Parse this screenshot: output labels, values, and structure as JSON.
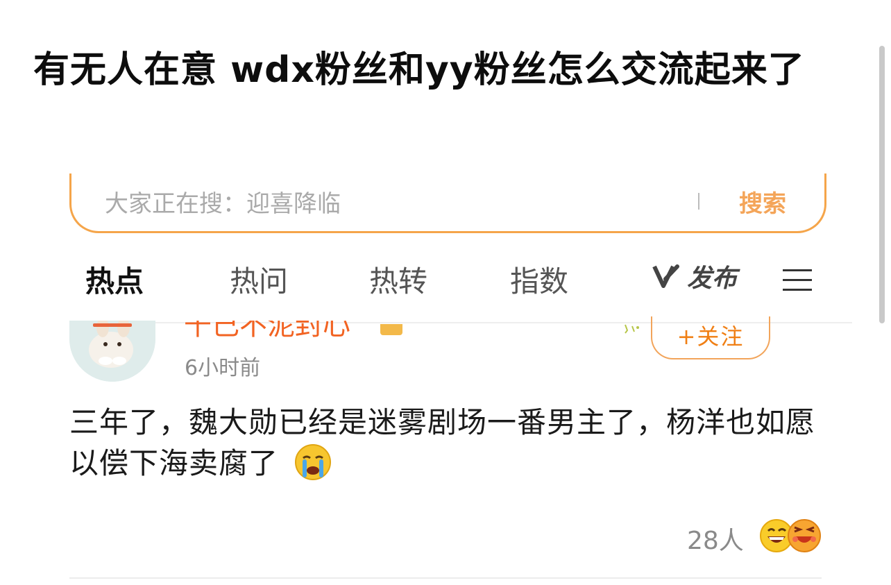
{
  "post": {
    "title": "有无人在意 wdx粉丝和yy粉丝怎么交流起来了"
  },
  "app": {
    "search": {
      "placeholder": "大家正在搜：迎喜降临",
      "button_label": "搜索"
    },
    "tabs": [
      {
        "label": "热点",
        "active": true
      },
      {
        "label": "热问",
        "active": false
      },
      {
        "label": "热转",
        "active": false
      },
      {
        "label": "指数",
        "active": false
      }
    ],
    "publish_label": "发布",
    "colors": {
      "accent": "#f07f14",
      "username": "#f26322",
      "search_border": "#f5a54a"
    }
  },
  "card": {
    "username": "千己不泥封心",
    "timestamp": "6小时前",
    "follow_label": "+关注",
    "text": "三年了，魏大勋已经是迷雾剧场一番男主了，杨洋也如愿以偿下海卖腐了",
    "inline_emoji": "crying-face",
    "likes": "28人",
    "reaction_emojis": [
      "grinning-face",
      "laughing-face"
    ]
  }
}
